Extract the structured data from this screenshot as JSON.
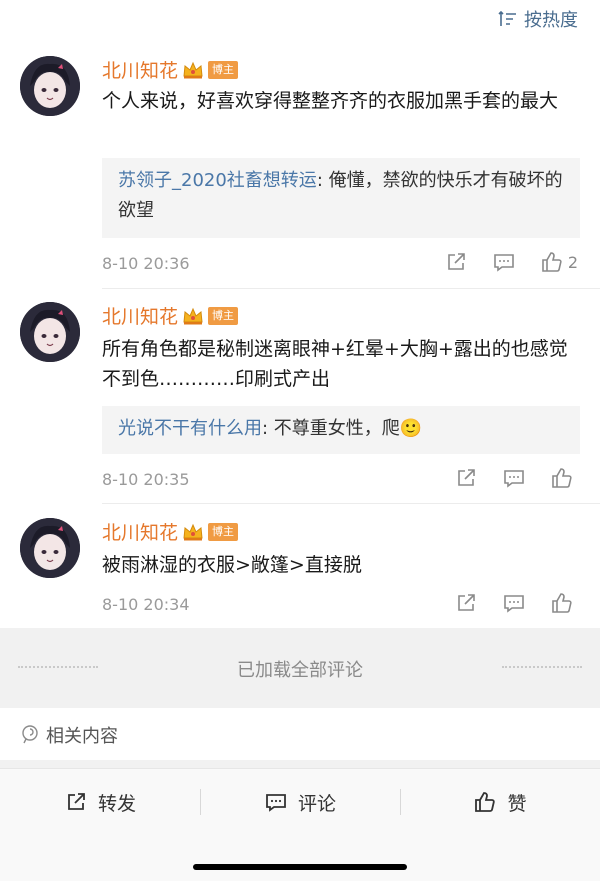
{
  "sort": {
    "label": "按热度"
  },
  "comments": [
    {
      "author": "北川知花",
      "badge": "博主",
      "text": "个人来说，好喜欢穿得整整齐齐的衣服加黑手套的最大",
      "reply_user": "苏领子_2020社畜想转运",
      "reply_text": ": 俺懂，禁欲的快乐才有破坏的欲望",
      "time": "8-10 20:36",
      "likes": "2"
    },
    {
      "author": "北川知花",
      "badge": "博主",
      "text": "所有角色都是秘制迷离眼神+红晕+大胸+露出的也感觉不到色…………印刷式产出",
      "reply_user": "光说不干有什么用",
      "reply_text": ": 不尊重女性，爬🙂",
      "time": "8-10 20:35",
      "likes": ""
    },
    {
      "author": "北川知花",
      "badge": "博主",
      "text": "被雨淋湿的衣服>敞篷>直接脱",
      "time": "8-10 20:34",
      "likes": ""
    }
  ],
  "loaded_text": "已加载全部评论",
  "related": {
    "label": "相关内容"
  },
  "toolbar": {
    "repost": "转发",
    "comment": "评论",
    "like": "赞"
  },
  "colors": {
    "author": "#e5782c",
    "link": "#4a77a8",
    "badge": "#f09b43"
  }
}
